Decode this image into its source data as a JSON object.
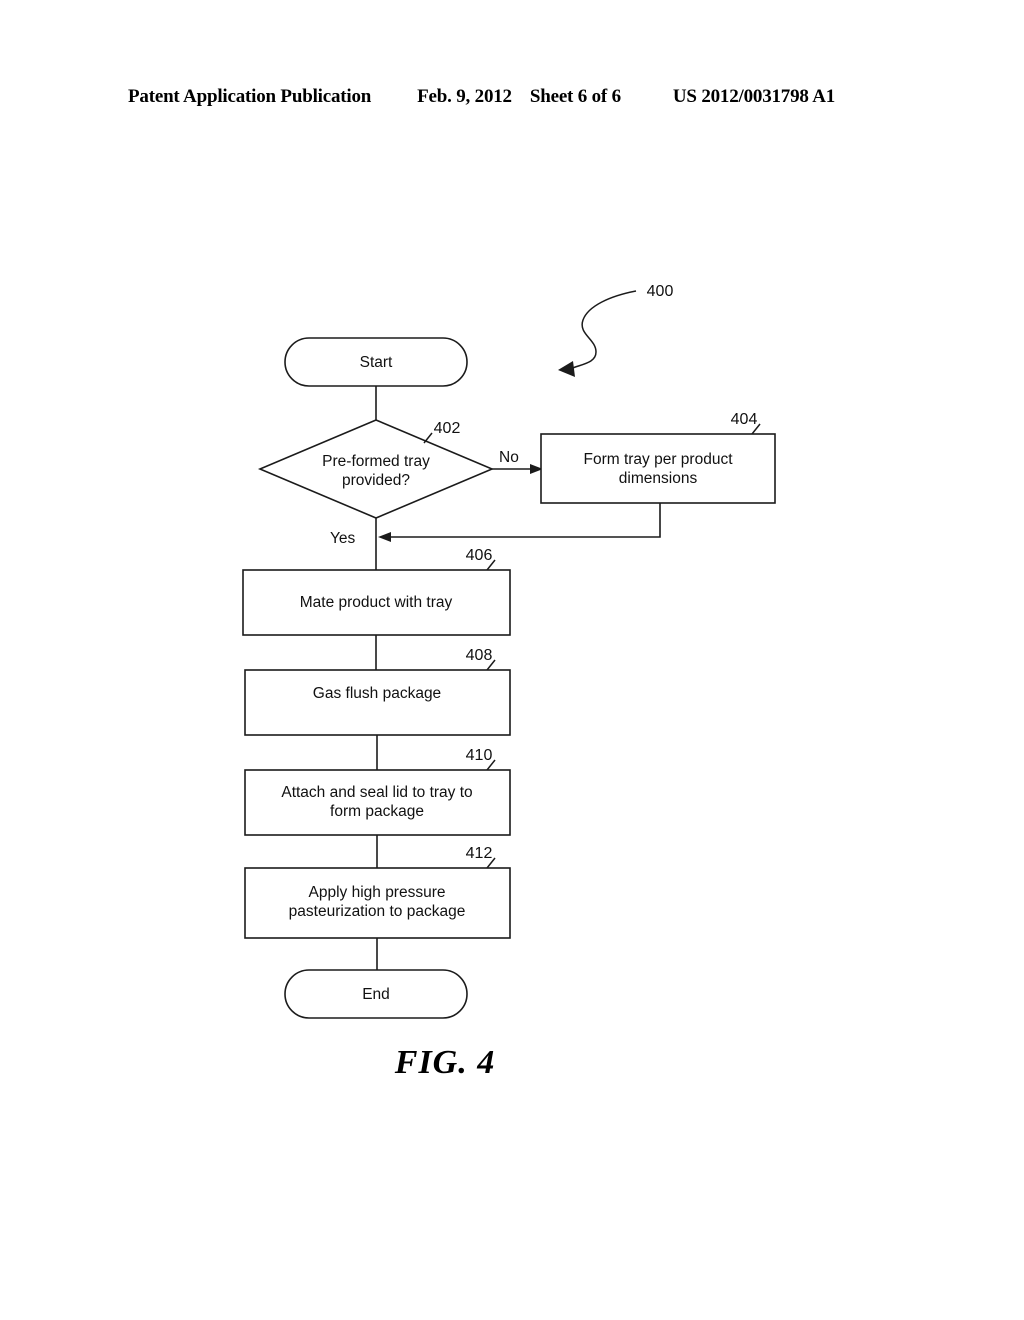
{
  "header": {
    "publication": "Patent Application Publication",
    "date": "Feb. 9, 2012",
    "sheet": "Sheet 6 of 6",
    "publication_number": "US 2012/0031798 A1"
  },
  "figure": {
    "caption": "FIG. 4",
    "diagram_reference": "400",
    "type": "flowchart"
  },
  "nodes": {
    "start": {
      "label": "Start",
      "shape": "terminator"
    },
    "decision_402": {
      "ref": "402",
      "line1": "Pre-formed tray",
      "line2": "provided?",
      "shape": "decision"
    },
    "process_404": {
      "ref": "404",
      "line1": "Form tray per product",
      "line2": "dimensions",
      "shape": "process"
    },
    "process_406": {
      "ref": "406",
      "line1": "Mate product with tray",
      "line2": "",
      "shape": "process"
    },
    "process_408": {
      "ref": "408",
      "line1": "Gas flush package",
      "line2": "",
      "shape": "process"
    },
    "process_410": {
      "ref": "410",
      "line1": "Attach and seal lid to tray to",
      "line2": "form package",
      "shape": "process"
    },
    "process_412": {
      "ref": "412",
      "line1": "Apply high pressure",
      "line2": "pasteurization to package",
      "shape": "process"
    },
    "end": {
      "label": "End",
      "shape": "terminator"
    }
  },
  "edges": {
    "no_label": "No",
    "yes_label": "Yes"
  },
  "colors": {
    "ink": "#1b1b1b",
    "paper": "#ffffff"
  }
}
